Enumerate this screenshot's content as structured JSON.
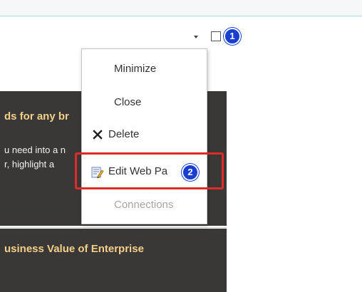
{
  "header": {
    "dropdown_icon": "chevron-down-icon",
    "checkbox_checked": false
  },
  "callouts": {
    "badge_1": "1",
    "badge_2": "2",
    "badge_color": "#1a3fd0",
    "highlight_color": "#e12b2b"
  },
  "menu": {
    "items": [
      {
        "label": "Minimize",
        "icon": null,
        "enabled": true
      },
      {
        "label": "Close",
        "icon": null,
        "enabled": true
      },
      {
        "label": "Delete",
        "icon": "delete-x-icon",
        "enabled": true
      },
      {
        "label": "Edit Web Pa",
        "icon": "edit-web-part-icon",
        "enabled": true
      },
      {
        "label": "Connections",
        "icon": null,
        "enabled": false
      }
    ]
  },
  "webparts": {
    "panel1": {
      "title": "ds for any br",
      "line1": "u need into a n",
      "line2": "r, highlight a"
    },
    "panel2": {
      "title": "usiness Value of Enterprise"
    },
    "title_color": "#f3cf8a",
    "panel_color": "#3a3836"
  }
}
